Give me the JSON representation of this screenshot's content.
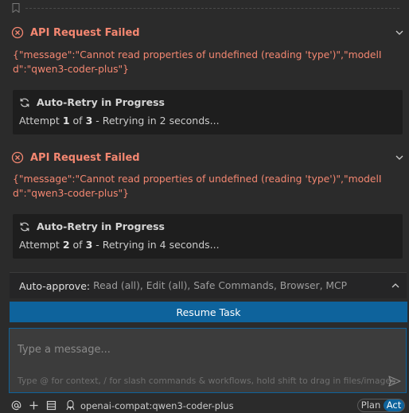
{
  "messages": [
    {
      "error_title": "API Request Failed",
      "error_message": "{\"message\":\"Cannot read properties of undefined (reading 'type')\",\"modelId\":\"qwen3-coder-plus\"}",
      "retry_title": "Auto-Retry in Progress",
      "attempt_prefix": "Attempt",
      "attempt_current": "1",
      "attempt_of": "of",
      "attempt_total": "3",
      "attempt_suffix": "- Retrying in 2 seconds..."
    },
    {
      "error_title": "API Request Failed",
      "error_message": "{\"message\":\"Cannot read properties of undefined (reading 'type')\",\"modelId\":\"qwen3-coder-plus\"}",
      "retry_title": "Auto-Retry in Progress",
      "attempt_prefix": "Attempt",
      "attempt_current": "2",
      "attempt_of": "of",
      "attempt_total": "3",
      "attempt_suffix": "- Retrying in 4 seconds..."
    }
  ],
  "auto_approve": {
    "label": "Auto-approve:",
    "items": "Read (all), Edit (all), Safe Commands, Browser, MCP"
  },
  "resume_button": "Resume Task",
  "chat_input": {
    "placeholder": "Type a message...",
    "hint": "Type @ for context, / for slash commands & workflows, hold shift to drag in files/images"
  },
  "bottom_bar": {
    "model": "openai-compat:qwen3-coder-plus",
    "mode_plan": "Plan",
    "mode_act": "Act"
  },
  "icons": {
    "bookmark": "bookmark-icon",
    "error": "error-circle-x-icon",
    "chevron_down": "chevron-down-icon",
    "chevron_up": "chevron-up-icon",
    "refresh": "refresh-icon",
    "send": "send-icon",
    "at": "at-icon",
    "plus": "plus-icon",
    "server": "server-icon",
    "model": "model-icon"
  },
  "colors": {
    "error": "#f48771",
    "accent": "#0e639c",
    "background": "#2b2b2b",
    "retry_box": "#1e1e1e"
  }
}
